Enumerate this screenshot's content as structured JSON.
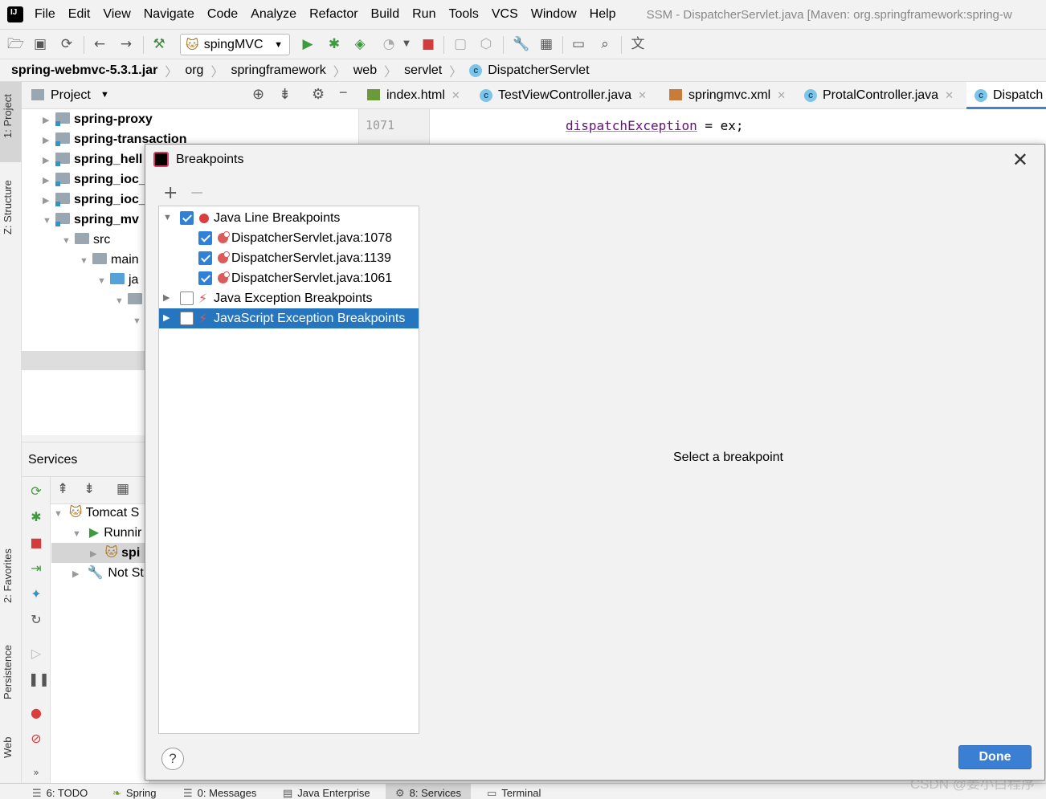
{
  "menubar": {
    "items": [
      "File",
      "Edit",
      "View",
      "Navigate",
      "Code",
      "Analyze",
      "Refactor",
      "Build",
      "Run",
      "Tools",
      "VCS",
      "Window",
      "Help"
    ],
    "window_title": "SSM - DispatcherServlet.java [Maven: org.springframework:spring-w"
  },
  "toolbar": {
    "run_config": "spingMVC"
  },
  "breadcrumb": [
    "spring-webmvc-5.3.1.jar",
    "org",
    "springframework",
    "web",
    "servlet",
    "DispatcherServlet"
  ],
  "left_stripe": {
    "tabs": [
      "1: Project",
      "Z: Structure",
      "2: Favorites",
      "Persistence",
      "Web"
    ]
  },
  "project": {
    "header": "Project",
    "tree": [
      {
        "label": "spring-proxy"
      },
      {
        "label": "spring-transaction"
      },
      {
        "label": "spring_hell"
      },
      {
        "label": "spring_ioc_"
      },
      {
        "label": "spring_ioc_"
      },
      {
        "label": "spring_mv"
      },
      {
        "label": "src"
      },
      {
        "label": "main"
      },
      {
        "label": "ja"
      }
    ]
  },
  "editor": {
    "tabs": [
      {
        "label": "index.html"
      },
      {
        "label": "TestViewController.java"
      },
      {
        "label": "springmvc.xml"
      },
      {
        "label": "ProtalController.java"
      },
      {
        "label": "Dispatch"
      }
    ],
    "line_number": "1071",
    "code_ident": "dispatchException",
    "code_rest": " = ex;"
  },
  "services": {
    "header": "Services",
    "tree": [
      {
        "label": "Tomcat S"
      },
      {
        "label": "Runnir"
      },
      {
        "label": "spi"
      },
      {
        "label": "Not St"
      }
    ]
  },
  "bottom_bar": {
    "tabs": [
      "6: TODO",
      "Spring",
      "0: Messages",
      "Java Enterprise",
      "8: Services",
      "Terminal"
    ]
  },
  "watermark": "CSDN @姜小白程序",
  "dialog": {
    "title": "Breakpoints",
    "empty_message": "Select a breakpoint",
    "help_label": "?",
    "done_label": "Done",
    "groups": [
      {
        "label": "Java Line Breakpoints",
        "checked": true,
        "expanded": true,
        "children": [
          {
            "label": "DispatcherServlet.java:1078",
            "checked": true
          },
          {
            "label": "DispatcherServlet.java:1139",
            "checked": true
          },
          {
            "label": "DispatcherServlet.java:1061",
            "checked": true
          }
        ]
      },
      {
        "label": "Java Exception Breakpoints",
        "checked": false,
        "expanded": false
      },
      {
        "label": "JavaScript Exception Breakpoints",
        "checked": false,
        "expanded": false,
        "selected": true
      }
    ]
  }
}
